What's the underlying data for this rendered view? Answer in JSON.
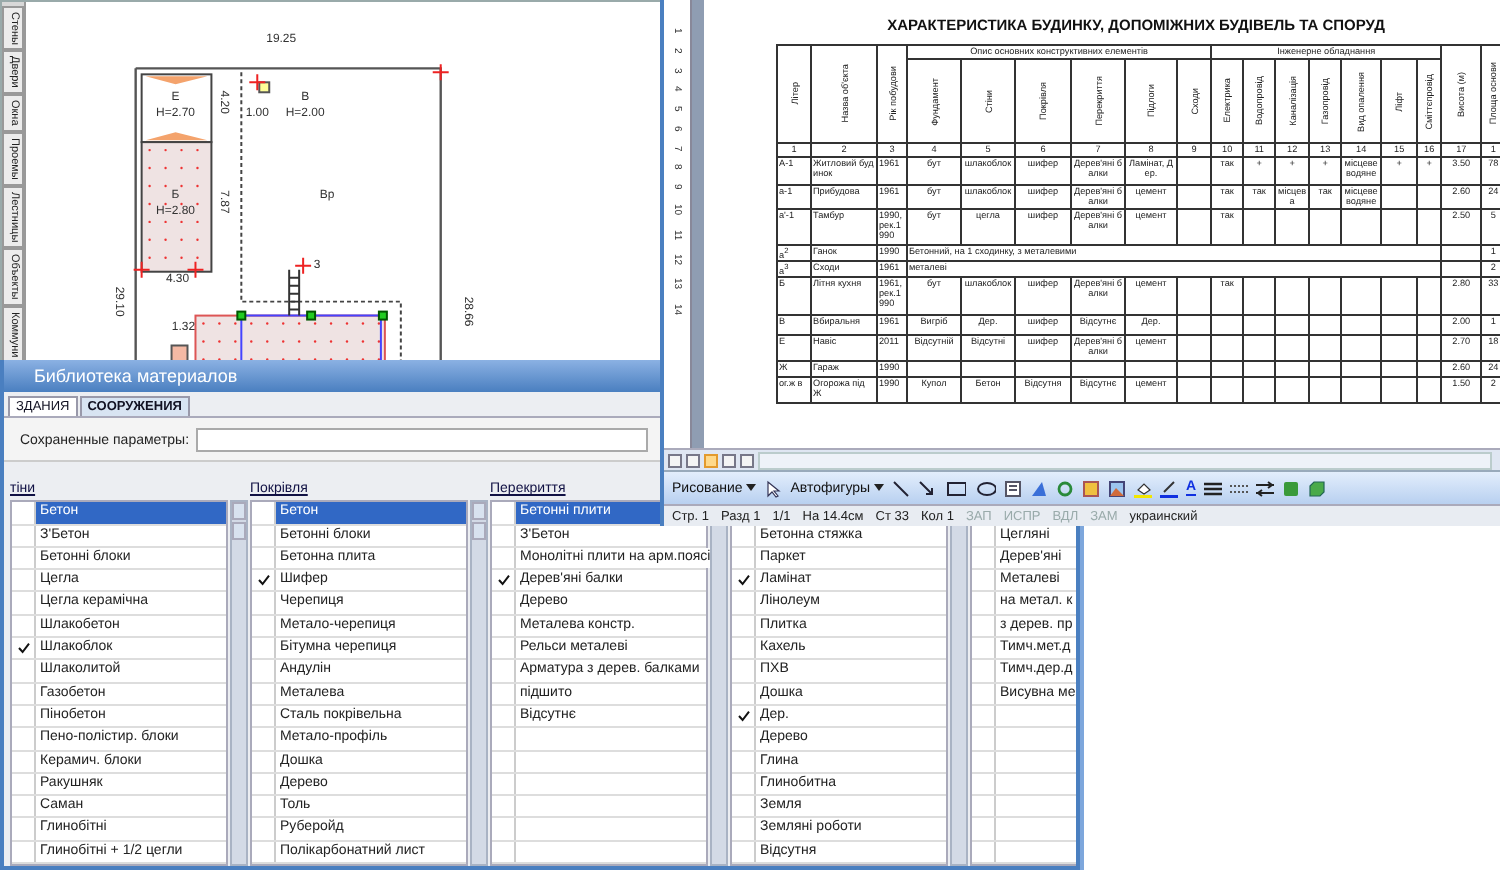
{
  "plan": {
    "tabs": [
      "Стены",
      "Двери",
      "Окна",
      "Проемы",
      "Лестницы",
      "Объекты",
      "Коммуни"
    ],
    "labels": [
      "19.25",
      "Е",
      "4.20",
      "В",
      "Н=2.70",
      "1.00",
      "Н=2.00",
      "Б",
      "7.87",
      "Вр",
      "Н=2.80",
      "3",
      "4.30",
      "29.10",
      "28.66",
      "1.32"
    ]
  },
  "library": {
    "title": "Библиотека материалов",
    "tabs": [
      {
        "label": "ЗДАНИЯ",
        "selected": true
      },
      {
        "label": "СООРУЖЕНИЯ",
        "selected": false
      }
    ],
    "saved_params": {
      "label": "Сохраненные параметры:"
    },
    "columns": [
      {
        "header": "тіни",
        "items": [
          {
            "label": "Бетон",
            "checked": false,
            "selected": true
          },
          {
            "label": "З'Бетон",
            "checked": false,
            "selected": false
          },
          {
            "label": "Бетонні блоки",
            "checked": false,
            "selected": false
          },
          {
            "label": "Цегла",
            "checked": false,
            "selected": false
          },
          {
            "label": "Цегла керамічна",
            "checked": false,
            "selected": false
          },
          {
            "label": "Шлакобетон",
            "checked": false,
            "selected": false
          },
          {
            "label": "Шлакоблок",
            "checked": true,
            "selected": false
          },
          {
            "label": "Шлаколитой",
            "checked": false,
            "selected": false
          },
          {
            "label": "Газобетон",
            "checked": false,
            "selected": false
          },
          {
            "label": "Пінобетон",
            "checked": false,
            "selected": false
          },
          {
            "label": "Пено-полістир. блоки",
            "checked": false,
            "selected": false
          },
          {
            "label": "Керамич. блоки",
            "checked": false,
            "selected": false
          },
          {
            "label": "Ракушняк",
            "checked": false,
            "selected": false
          },
          {
            "label": "Саман",
            "checked": false,
            "selected": false
          },
          {
            "label": "Глинобітні",
            "checked": false,
            "selected": false
          },
          {
            "label": "Глинобітні + 1/2 цегли",
            "checked": false,
            "selected": false
          }
        ]
      },
      {
        "header": "Покрівля",
        "items": [
          {
            "label": "Бетон",
            "checked": false,
            "selected": true
          },
          {
            "label": "Бетонні блоки",
            "checked": false,
            "selected": false
          },
          {
            "label": "Бетонна плита",
            "checked": false,
            "selected": false
          },
          {
            "label": "Шифер",
            "checked": true,
            "selected": false
          },
          {
            "label": "Черепиця",
            "checked": false,
            "selected": false
          },
          {
            "label": "Метало-черепиця",
            "checked": false,
            "selected": false
          },
          {
            "label": "Бітумна черепиця",
            "checked": false,
            "selected": false
          },
          {
            "label": "Андулін",
            "checked": false,
            "selected": false
          },
          {
            "label": "Металева",
            "checked": false,
            "selected": false
          },
          {
            "label": "Сталь покрівельна",
            "checked": false,
            "selected": false
          },
          {
            "label": "Метало-профіль",
            "checked": false,
            "selected": false
          },
          {
            "label": "Дошка",
            "checked": false,
            "selected": false
          },
          {
            "label": "Дерево",
            "checked": false,
            "selected": false
          },
          {
            "label": "Толь",
            "checked": false,
            "selected": false
          },
          {
            "label": "Руберойд",
            "checked": false,
            "selected": false
          },
          {
            "label": "Полікарбонатний лист",
            "checked": false,
            "selected": false
          }
        ]
      },
      {
        "header": "Перекриття",
        "items": [
          {
            "label": "Бетонні плити",
            "checked": false,
            "selected": true
          },
          {
            "label": "З'Бетон",
            "checked": false,
            "selected": false
          },
          {
            "label": "Монолітні плити на арм.поясі",
            "checked": false,
            "selected": false
          },
          {
            "label": "Дерев'яні балки",
            "checked": true,
            "selected": false
          },
          {
            "label": "Дерево",
            "checked": false,
            "selected": false
          },
          {
            "label": "Металева констр.",
            "checked": false,
            "selected": false
          },
          {
            "label": "Рельси металеві",
            "checked": false,
            "selected": false
          },
          {
            "label": "Арматура з дерев. балками",
            "checked": false,
            "selected": false
          },
          {
            "label": "підшито",
            "checked": false,
            "selected": false
          },
          {
            "label": "Відсутнє",
            "checked": false,
            "selected": false
          }
        ]
      },
      {
        "items": [
          {
            "label": "Бетонна стяжка",
            "checked": false,
            "selected": false
          },
          {
            "label": "Паркет",
            "checked": false,
            "selected": false
          },
          {
            "label": "Ламінат",
            "checked": true,
            "selected": false
          },
          {
            "label": "Лінолеум",
            "checked": false,
            "selected": false
          },
          {
            "label": "Плитка",
            "checked": false,
            "selected": false
          },
          {
            "label": "Кахель",
            "checked": false,
            "selected": false
          },
          {
            "label": "ПХВ",
            "checked": false,
            "selected": false
          },
          {
            "label": "Дошка",
            "checked": false,
            "selected": false
          },
          {
            "label": "Дер.",
            "checked": true,
            "selected": false
          },
          {
            "label": "Дерево",
            "checked": false,
            "selected": false
          },
          {
            "label": "Глина",
            "checked": false,
            "selected": false
          },
          {
            "label": "Глинобитна",
            "checked": false,
            "selected": false
          },
          {
            "label": "Земля",
            "checked": false,
            "selected": false
          },
          {
            "label": "Земляні роботи",
            "checked": false,
            "selected": false
          },
          {
            "label": "Відсутня",
            "checked": false,
            "selected": false
          }
        ]
      },
      {
        "items": [
          {
            "label": "Цегляні",
            "checked": false,
            "selected": false
          },
          {
            "label": "Дерев'яні",
            "checked": false,
            "selected": false
          },
          {
            "label": "Металеві",
            "checked": false,
            "selected": false
          },
          {
            "label": "на метал. к",
            "checked": false,
            "selected": false
          },
          {
            "label": "з дерев. пр",
            "checked": false,
            "selected": false
          },
          {
            "label": "Тимч.мет.д",
            "checked": false,
            "selected": false
          },
          {
            "label": "Тимч.дер.д",
            "checked": false,
            "selected": false
          },
          {
            "label": "Висувна ме",
            "checked": false,
            "selected": false
          }
        ]
      }
    ]
  },
  "document": {
    "ruler": [
      "1",
      "2",
      "3",
      "4",
      "5",
      "6",
      "7",
      "8",
      "9",
      "10",
      "11",
      "12",
      "13",
      "14"
    ],
    "title": "ХАРАКТЕРИСТИКА БУДИНКУ, ДОПОМІЖНИХ БУДІВЕЛЬ ТА СПОРУД",
    "lead_columns": [
      "Літер",
      "Назва об'єкта",
      "Рік побудови"
    ],
    "groups": [
      {
        "label": "Опис основних конструктивних елементів",
        "columns": [
          "Фундамент",
          "Стіни",
          "Покрівля",
          "Перекриття",
          "Підлоги",
          "Сходи"
        ]
      },
      {
        "label": "Інженерне обладнання",
        "columns": [
          "Електрика",
          "Водопровід",
          "Каналізація",
          "Газопровід",
          "Вид опалення",
          "Ліфт",
          "Сміттєпровід"
        ]
      }
    ],
    "tail_columns": [
      "Висота (м)",
      "Площа основи"
    ],
    "numbers": [
      "1",
      "2",
      "3",
      "4",
      "5",
      "6",
      "7",
      "8",
      "9",
      "10",
      "11",
      "12",
      "13",
      "14",
      "15",
      "16",
      "17",
      "1"
    ],
    "rows": [
      {
        "kind": "full",
        "cells": [
          "А-1",
          "Житловий будинок",
          "1961",
          "бут",
          "шлакоблок",
          "шифер",
          "Дерев'яні балки",
          "Ламінат, Дер.",
          null,
          "так",
          "+",
          "+",
          "+",
          "місцеве водяне",
          "+",
          "+",
          "3.50",
          "78"
        ]
      },
      {
        "kind": "full",
        "cells": [
          "а-1",
          "Прибудова",
          "1961",
          "бут",
          "шлакоблок",
          "шифер",
          "Дерев'яні балки",
          "цемент",
          null,
          "так",
          "так",
          "місцева",
          "так",
          "місцеве водяне",
          null,
          null,
          "2.60",
          "24"
        ]
      },
      {
        "kind": "full",
        "cells": [
          "а'-1",
          "Тамбур",
          "1990, рек.1990",
          "бут",
          "цегла",
          "шифер",
          "Дерев'яні балки",
          "цемент",
          null,
          "так",
          null,
          null,
          null,
          null,
          null,
          null,
          "2.50",
          "5"
        ]
      },
      {
        "kind": "note",
        "cells": [
          "а$^{2}$",
          "Ганок",
          "1990"
        ],
        "note": "Бетонний, на 1 сходинку, з металевими",
        "tail": [
          "1"
        ]
      },
      {
        "kind": "note",
        "cells": [
          "а$^{3}$",
          "Сходи",
          "1961"
        ],
        "note": "металеві",
        "tail": [
          "2"
        ]
      },
      {
        "kind": "full",
        "cells": [
          "Б",
          "Літня кухня",
          "1961, рек.1990",
          "бут",
          "шлакоблок",
          "шифер",
          "Дерев'яні балки",
          "цемент",
          null,
          "так",
          null,
          null,
          null,
          null,
          null,
          null,
          "2.80",
          "33"
        ]
      },
      {
        "kind": "full",
        "cells": [
          "В",
          "Вбиральня",
          "1961",
          "Вигріб",
          "Дер.",
          "шифер",
          "Відсутнє",
          "Дер.",
          null,
          null,
          null,
          null,
          null,
          null,
          null,
          null,
          "2.00",
          "1"
        ]
      },
      {
        "kind": "full",
        "cells": [
          "Е",
          "Навіс",
          "2011",
          "Відсутній",
          "Відсутні",
          "шифер",
          "Дерев'яні балки",
          "цемент",
          null,
          null,
          null,
          null,
          null,
          null,
          null,
          null,
          "2.70",
          "18"
        ]
      },
      {
        "kind": "full",
        "cells": [
          "Ж",
          "Гараж",
          "1990",
          null,
          null,
          null,
          null,
          null,
          null,
          null,
          null,
          null,
          null,
          null,
          null,
          null,
          "2.60",
          "24"
        ]
      },
      {
        "kind": "full",
        "cells": [
          "ог.ж в",
          "Огорожа під Ж",
          "1990",
          "Купол",
          "Бетон",
          "Відсутня",
          "Відсутнє",
          "цемент",
          null,
          null,
          null,
          null,
          null,
          null,
          null,
          null,
          "1.50",
          "2"
        ]
      }
    ]
  },
  "view_buttons": [
    {
      "selected": false
    },
    {
      "selected": false
    },
    {
      "selected": true
    },
    {
      "selected": false
    },
    {
      "selected": false
    }
  ],
  "drawing_toolbar": {
    "menu": "Рисование",
    "autoshapes": "Автофигуры",
    "font_color": "A"
  },
  "status_bar": [
    {
      "text": "Стр. 1",
      "disabled": false
    },
    {
      "text": "Разд 1",
      "disabled": false
    },
    {
      "text": "1/1",
      "disabled": false
    },
    {
      "text": "На 14.4см",
      "disabled": false
    },
    {
      "text": "Ст 33",
      "disabled": false
    },
    {
      "text": "Кол 1",
      "disabled": false
    },
    {
      "text": "ЗАП",
      "disabled": true
    },
    {
      "text": "ИСПР",
      "disabled": true
    },
    {
      "text": "ВДЛ",
      "disabled": true
    },
    {
      "text": "ЗАМ",
      "disabled": true
    },
    {
      "text": "украинский",
      "disabled": false
    }
  ]
}
